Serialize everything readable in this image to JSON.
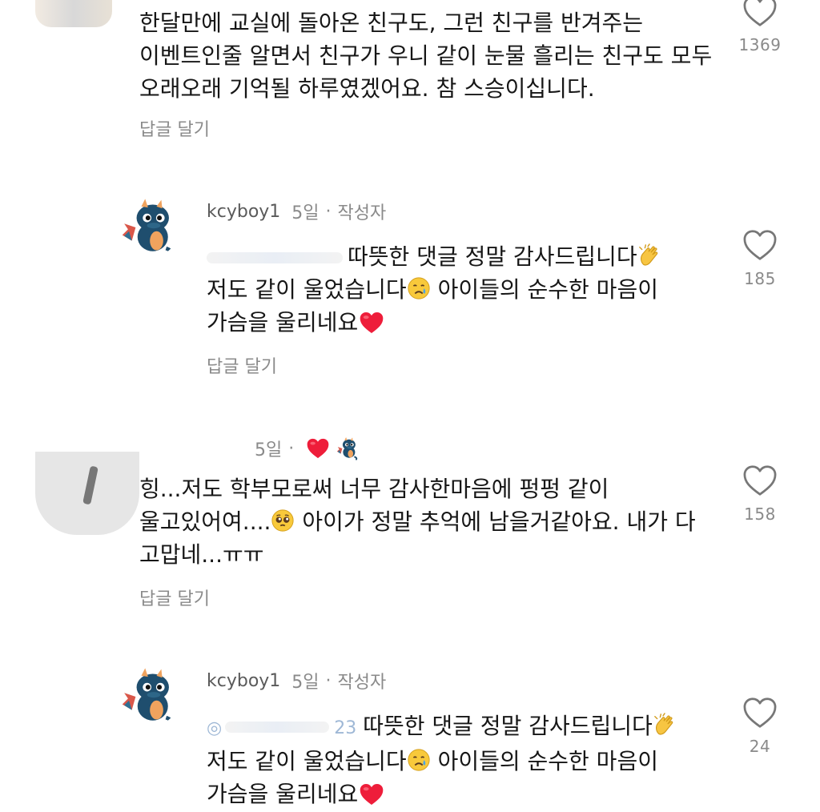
{
  "comments": [
    {
      "lines": [
        "한달만에 교실에 돌아온 친구도, 그런 친구를 반겨주는",
        "이벤트인줄 알면서 친구가 우니 같이 눈물 흘리는 친구도 모두",
        "오래오래 기억될 하루였겠어요. 참 스승이십니다."
      ],
      "reply": "답글 달기",
      "likes": "1369"
    },
    {
      "username": "kcyboy1",
      "age": "5일",
      "dot": "·",
      "author_tag": "작성자",
      "line1": "따뜻한 댓글 정말 감사드립니다",
      "line2a": "저도 같이 울었습니다",
      "line2b": "아이들의 순수한 마음이",
      "line3": "가슴을 울리네요",
      "reply": "답글 달기",
      "likes": "185"
    },
    {
      "age": "5일",
      "dot": "·",
      "line1": "힝...저도 학부모로써 너무 감사한마음에 펑펑 같이",
      "line2a": "울고있어여....",
      "line2b": "아이가 정말 추억에 남을거같아요. 내가 다",
      "line3": "고맙네...ㅠㅠ",
      "reply": "답글 달기",
      "likes": "158"
    },
    {
      "username": "kcyboy1",
      "age": "5일",
      "dot": "·",
      "author_tag": "작성자",
      "mention_prefix": "◎",
      "mention_suffix": "23",
      "line1": "따뜻한 댓글 정말 감사드립니다",
      "line2a": "저도 같이 울었습니다",
      "line2b": "아이들의 순수한 마음이",
      "line3": "가슴을 울리네요",
      "likes": "24"
    }
  ],
  "icons": {
    "like": "heart-outline-icon",
    "clap": "clapping-hands-emoji",
    "cry": "crying-face-emoji",
    "pleading": "pleading-face-emoji",
    "red_heart": "red-heart-emoji",
    "creator_liked": "red-heart-icon"
  },
  "colors": {
    "text": "#161616",
    "muted": "#8a8a8a",
    "heart_red": "#ee1d3a",
    "avatar_dragon": "#1f4e6e"
  }
}
